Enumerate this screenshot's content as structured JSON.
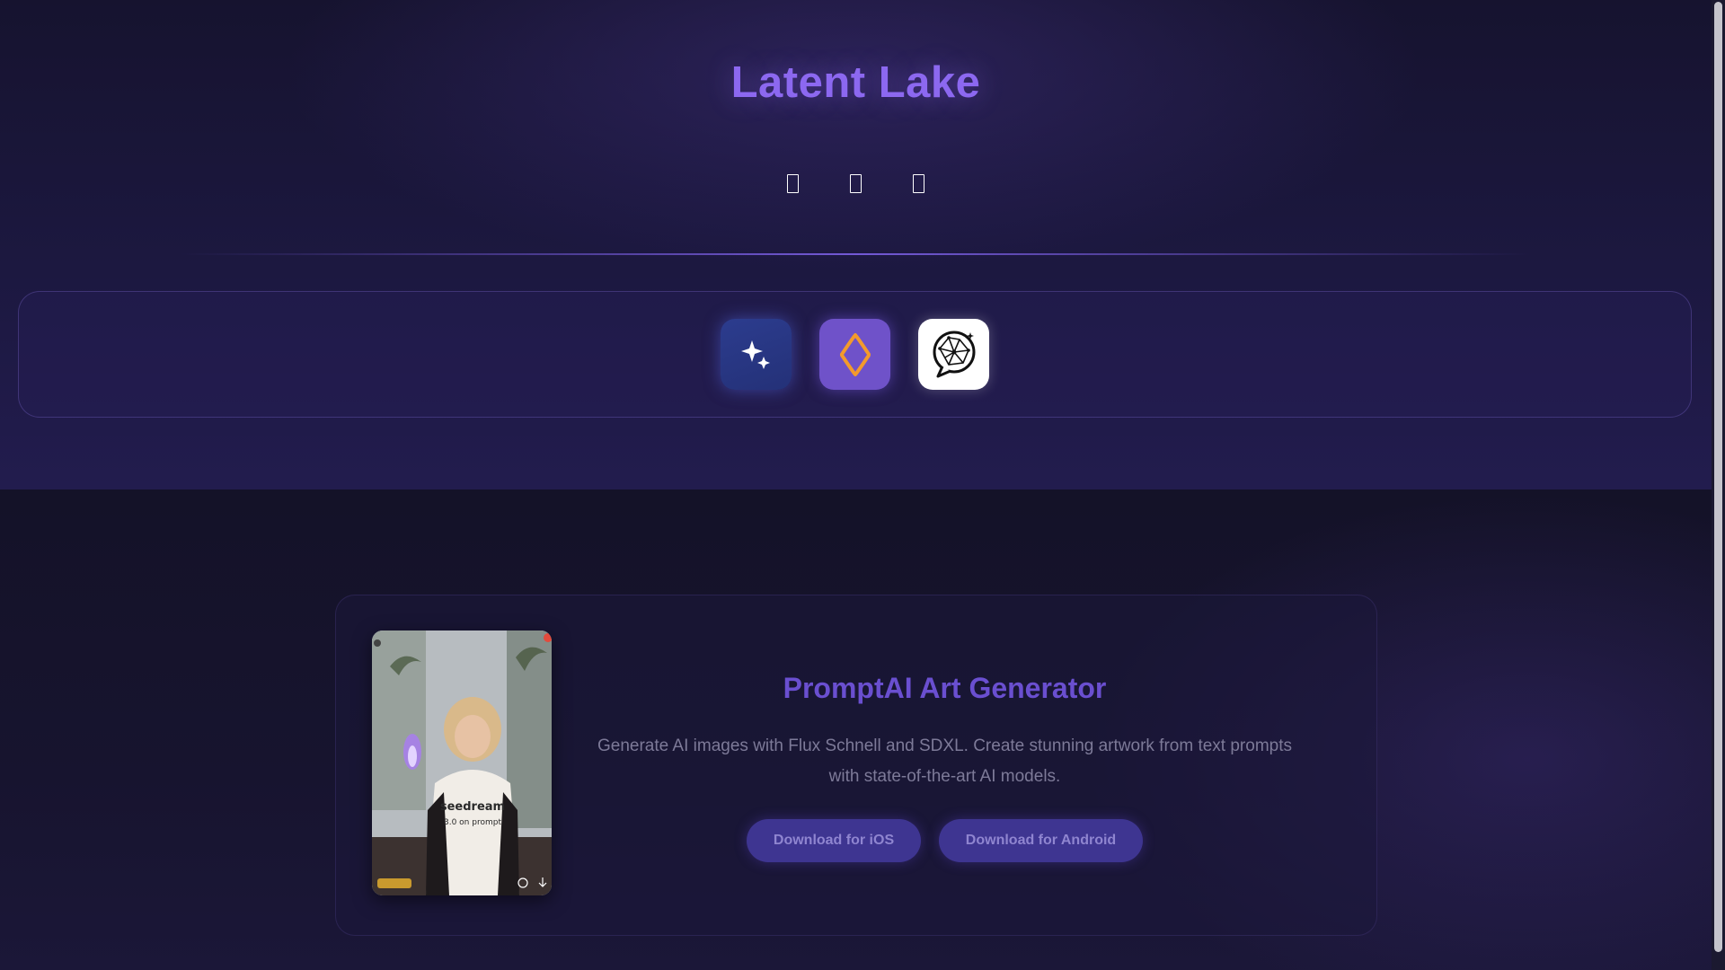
{
  "header": {
    "site_title": "Latent Lake",
    "social_links": [
      {
        "icon": "social-icon-1"
      },
      {
        "icon": "social-icon-2"
      },
      {
        "icon": "social-icon-3"
      }
    ]
  },
  "apps_bar": {
    "apps": [
      {
        "icon": "sparkle-icon",
        "color": "#2c3c8e"
      },
      {
        "icon": "diamond-icon",
        "color": "#6f52c9",
        "accent": "#f39a2c"
      },
      {
        "icon": "chat-brain-icon",
        "color": "#ffffff"
      }
    ]
  },
  "feature": {
    "title": "PromptAI Art Generator",
    "description": "Generate AI images with Flux Schnell and SDXL. Create stunning artwork from text prompts with state-of-the-art AI models.",
    "screenshot_caption": "seedream 3.0 on prompt",
    "buttons": {
      "ios_label": "Download for iOS",
      "android_label": "Download for Android"
    }
  },
  "colors": {
    "accent": "#8c68f0",
    "background": "#14112b",
    "button": "#3e3591"
  }
}
